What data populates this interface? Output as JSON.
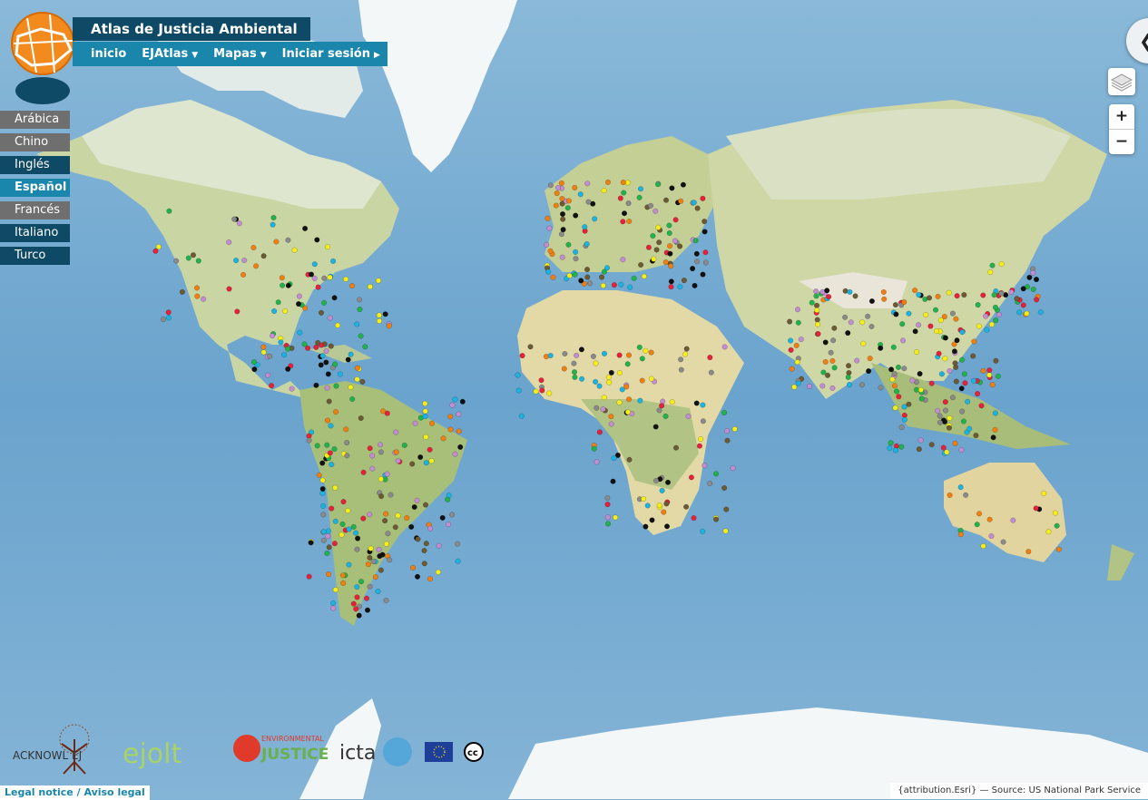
{
  "app": {
    "title": "Atlas de Justicia Ambiental"
  },
  "nav": {
    "home": "inicio",
    "ejatlas": "EJAtlas",
    "maps": "Mapas",
    "login": "Iniciar sesión"
  },
  "languages": [
    "Arábica",
    "Chino",
    "Inglés",
    "Español",
    "Francés",
    "Italiano",
    "Turco"
  ],
  "active_language": "Español",
  "map": {
    "zoom_in": "+",
    "zoom_out": "−",
    "attribution": "{attribution.Esri} — Source: US National Park Service",
    "legal": "Legal notice / Aviso legal",
    "marker_colors": [
      "#111111",
      "#f07f12",
      "#1db3e0",
      "#f5ee1a",
      "#22b24c",
      "#e5223a",
      "#6b5a33",
      "#c38dd1",
      "#8a8a8a"
    ]
  },
  "logos": {
    "acknowlej": "ACKNOWL EJ",
    "ejolt": "ejolt",
    "ej_top": "ENVIRONMENTAL",
    "ej_bottom": "JUSTICE",
    "icta": "icta",
    "cc": "cc"
  },
  "icons": {
    "back": "chevron-left-icon",
    "layers": "layers-icon"
  }
}
